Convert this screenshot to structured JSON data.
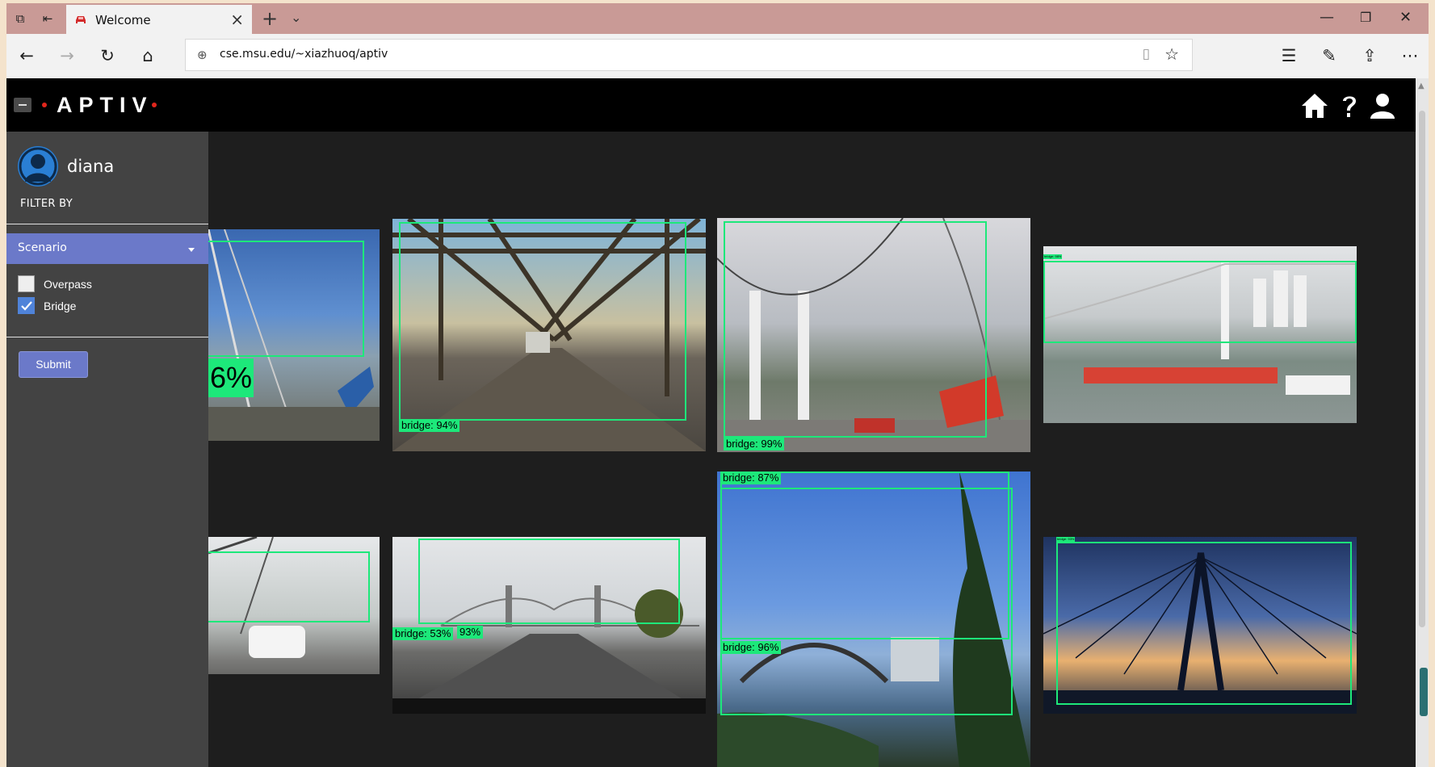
{
  "browser": {
    "tab_title": "Welcome",
    "url": "cse.msu.edu/~xiazhuoq/aptiv"
  },
  "app": {
    "logo_text": "APTIV",
    "brand_red": "#e1261c",
    "accent": "#6b79c9"
  },
  "sidebar": {
    "username": "diana",
    "filter_by_label": "FILTER BY",
    "scenario_label": "Scenario",
    "options": [
      {
        "label": "Overpass",
        "checked": false
      },
      {
        "label": "Bridge",
        "checked": true
      }
    ],
    "submit_label": "Submit"
  },
  "gallery": {
    "detections": [
      {
        "label": "6%"
      },
      {
        "label": "bridge: 94%"
      },
      {
        "label": "bridge: 99%"
      },
      {
        "label": "bridge: 98%"
      },
      {
        "label": "bridge: 53%"
      },
      {
        "label": "93%"
      },
      {
        "label": "bridge: 87%"
      },
      {
        "label": "bridge: 96%"
      },
      {
        "label": "bridge: 93%"
      }
    ]
  }
}
